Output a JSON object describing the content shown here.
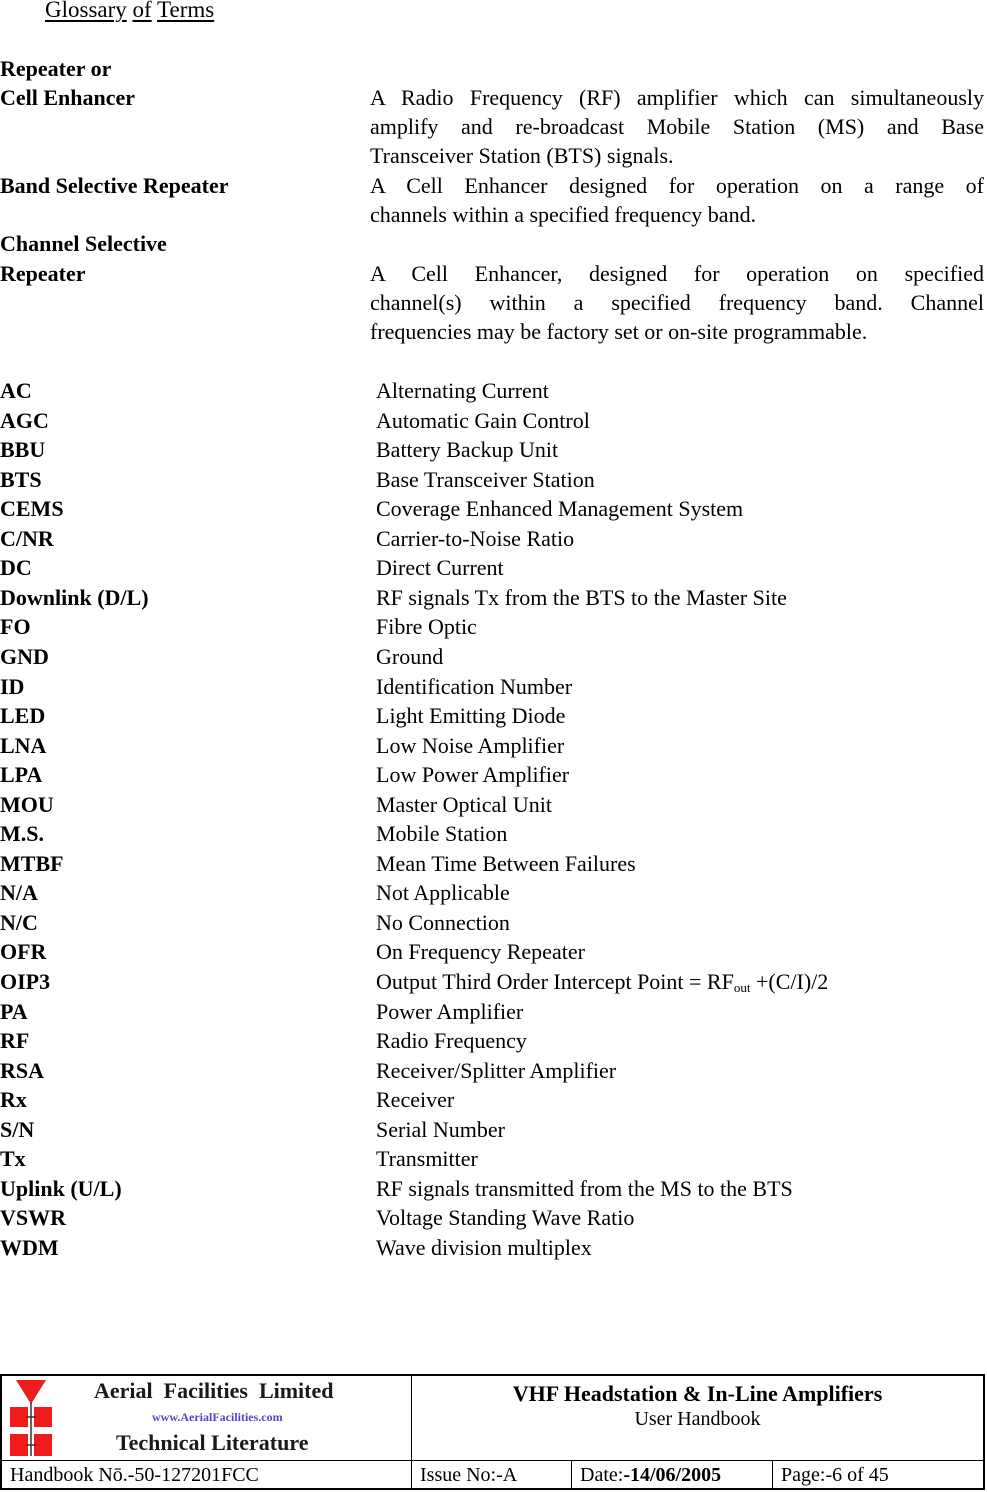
{
  "heading": {
    "words": [
      "Glossary",
      "of",
      "Terms"
    ]
  },
  "definitions": [
    {
      "term_lines": [
        "Repeater or",
        "Cell Enhancer"
      ],
      "definition_lines": [
        "A Radio Frequency (RF) amplifier which can simultaneously",
        "amplify and re-broadcast Mobile Station (MS) and Base",
        "Transceiver Station (BTS) signals."
      ]
    },
    {
      "term_lines": [
        "Band Selective Repeater"
      ],
      "definition_lines": [
        "A Cell Enhancer designed for operation on a range of",
        "channels within a specified frequency band."
      ]
    },
    {
      "term_lines": [
        "Channel Selective",
        "Repeater"
      ],
      "definition_lines": [
        "A Cell Enhancer, designed for operation on specified",
        "channel(s) within a specified frequency band. Channel",
        "frequencies may be factory set or on-site programmable."
      ]
    }
  ],
  "abbreviations": [
    {
      "abbr": "AC",
      "meaning": "Alternating Current"
    },
    {
      "abbr": "AGC",
      "meaning": "Automatic Gain Control"
    },
    {
      "abbr": "BBU",
      "meaning": "Battery Backup Unit"
    },
    {
      "abbr": "BTS",
      "meaning": "Base Transceiver Station"
    },
    {
      "abbr": "CEMS",
      "meaning": "Coverage Enhanced Management System"
    },
    {
      "abbr": "C/NR",
      "meaning": "Carrier-to-Noise Ratio"
    },
    {
      "abbr": "DC",
      "meaning": "Direct Current"
    },
    {
      "abbr": "Downlink (D/L)",
      "meaning": "RF signals Tx from the BTS to the Master Site"
    },
    {
      "abbr": "FO",
      "meaning": "Fibre Optic"
    },
    {
      "abbr": "GND",
      "meaning": "Ground"
    },
    {
      "abbr": "ID",
      "meaning": "Identification Number"
    },
    {
      "abbr": "LED",
      "meaning": "Light Emitting Diode"
    },
    {
      "abbr": "LNA",
      "meaning": "Low Noise Amplifier"
    },
    {
      "abbr": "LPA",
      "meaning": "Low Power Amplifier"
    },
    {
      "abbr": "MOU",
      "meaning": "Master Optical Unit"
    },
    {
      "abbr": "M.S.",
      "meaning": "Mobile Station"
    },
    {
      "abbr": "MTBF",
      "meaning": "Mean Time Between Failures"
    },
    {
      "abbr": "N/A",
      "meaning": "Not Applicable"
    },
    {
      "abbr": "N/C",
      "meaning": "No Connection"
    },
    {
      "abbr": "OFR",
      "meaning": "On Frequency Repeater"
    },
    {
      "abbr": "OIP3",
      "meaning": "Output Third Order Intercept Point = RF",
      "meaning_sub": "out",
      "meaning_after": " +(C/I)/2"
    },
    {
      "abbr": "PA",
      "meaning": "Power Amplifier"
    },
    {
      "abbr": "RF",
      "meaning": "Radio Frequency"
    },
    {
      "abbr": "RSA",
      "meaning": "Receiver/Splitter Amplifier"
    },
    {
      "abbr": "Rx",
      "meaning": "Receiver"
    },
    {
      "abbr": "S/N",
      "meaning": "Serial Number"
    },
    {
      "abbr": "Tx",
      "meaning": "Transmitter"
    },
    {
      "abbr": "Uplink (U/L)",
      "meaning": "RF signals transmitted from the MS to the BTS"
    },
    {
      "abbr": "VSWR",
      "meaning": "Voltage Standing Wave Ratio"
    },
    {
      "abbr": "WDM",
      "meaning": "Wave division multiplex"
    }
  ],
  "footer": {
    "company": "Aerial  Facilities  Limited",
    "website": "www.AerialFacilities.com",
    "literature": "Technical Literature",
    "product_title": "VHF Headstation & In-Line Amplifiers",
    "product_subtitle": "User Handbook",
    "handbook_no": "Handbook Nō.-50-127201FCC",
    "issue_no": "Issue No:-A",
    "date_label": "Date:",
    "date_value": "-14/06/2005",
    "page_label": "Page:",
    "page_value": "-6 of 45",
    "logo_colors": {
      "red": "#ee1c1c",
      "line": "#333333"
    }
  }
}
